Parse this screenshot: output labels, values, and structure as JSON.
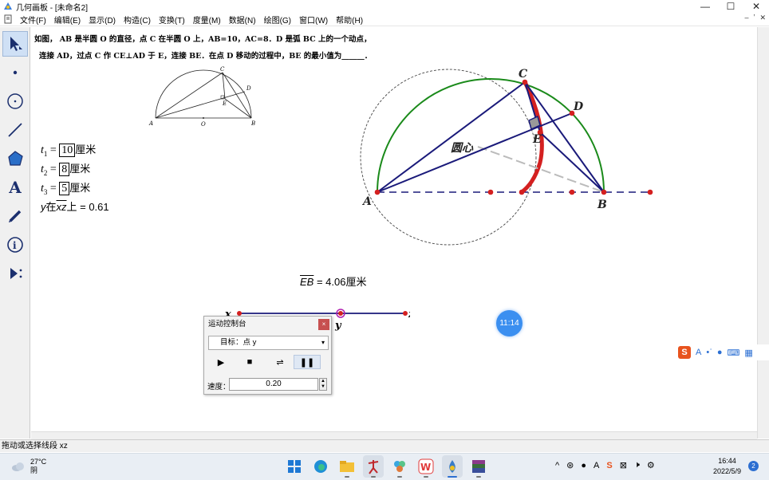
{
  "window": {
    "title": "几何画板 - [未命名2]",
    "minimize": "—",
    "maximize": "☐",
    "close": "✕"
  },
  "menu": {
    "items": [
      "文件(F)",
      "编辑(E)",
      "显示(D)",
      "构造(C)",
      "变换(T)",
      "度量(M)",
      "数据(N)",
      "绘图(G)",
      "窗口(W)",
      "帮助(H)"
    ],
    "mdi_buttons": [
      "–",
      "ʼ",
      "✕"
    ]
  },
  "toolbox": {
    "tools": [
      "arrow-tool",
      "point-tool",
      "compass-tool",
      "straightedge-tool",
      "polygon-tool",
      "text-tool",
      "marker-tool",
      "information-tool",
      "custom-tool"
    ],
    "text_tool_glyph": "A"
  },
  "problem": {
    "line1": "如图， AB 是半圆 O 的直径，点 C 在半圆 O 上，AB=10，AC=8．D 是弧 BC 上的一个动点，",
    "line2": "连接 AD，过点 C 作 CE⊥AD 于 E，连接 BE．在点 D 移动的过程中，BE 的最小值为______．"
  },
  "small_figure": {
    "labels": {
      "A": "A",
      "O": "O",
      "B": "B",
      "C": "C",
      "D": "D",
      "E": "E"
    }
  },
  "measurements": {
    "t1_label": "t",
    "t1_sub": "1",
    "t1_eq": " = ",
    "t1_value": "10",
    "t1_unit": "厘米",
    "t2_label": "t",
    "t2_sub": "2",
    "t2_eq": " = ",
    "t2_value": "8",
    "t2_unit": "厘米",
    "t3_label": "t",
    "t3_sub": "3",
    "t3_eq": " = ",
    "t3_value": "5",
    "t3_unit": "厘米",
    "y_label": "y",
    "y_on": "在",
    "y_segment": "xz",
    "y_suffix": "上 = 0.61"
  },
  "main_figure": {
    "labels": {
      "A": "A",
      "B": "B",
      "C": "C",
      "D": "D",
      "E": "E",
      "center": "圆心"
    },
    "colors": {
      "semicircle": "#1a8a1a",
      "segments": "#1a1a7a",
      "locus": "#d42020",
      "point": "#d42020",
      "dashed_circle": "#444444",
      "helper": "#bbbbbb"
    }
  },
  "slider": {
    "x_label": "x",
    "y_label": "y",
    "z_label": "z",
    "color": "#1a1a7a",
    "point_color": "#b01fb0",
    "position_fraction": 0.61
  },
  "eb_measure": {
    "label": "EB",
    "value": " = 4.06厘米"
  },
  "motion_panel": {
    "title": "运动控制台",
    "close": "×",
    "target": "目标：点 y",
    "target_arrow": "▾",
    "play": "▶",
    "stop": "■",
    "reverse": "⇌",
    "pause": "❚❚",
    "speed_label": "速度：",
    "speed_value": "0.20",
    "spin_up": "▲",
    "spin_down": "▼"
  },
  "floating_clock": "11:14",
  "ime": {
    "s_logo": "S",
    "items": [
      "A",
      "•ʾ",
      "🎤",
      "⌨",
      "▦"
    ]
  },
  "status": "拖动或选择线段 xz",
  "taskbar": {
    "temp": "27°C",
    "weather": "阴",
    "apps": [
      "windows-start",
      "edge-browser",
      "file-explorer",
      "sketchpad-app",
      "photos-app",
      "wps-office",
      "geometry-app",
      "winrar-app"
    ],
    "tray": [
      "^",
      "⊛",
      "🎤",
      "A",
      "S",
      "⊠",
      "🕨",
      "⚙"
    ],
    "time": "16:44",
    "date": "2022/5/9",
    "notifications": "2"
  }
}
